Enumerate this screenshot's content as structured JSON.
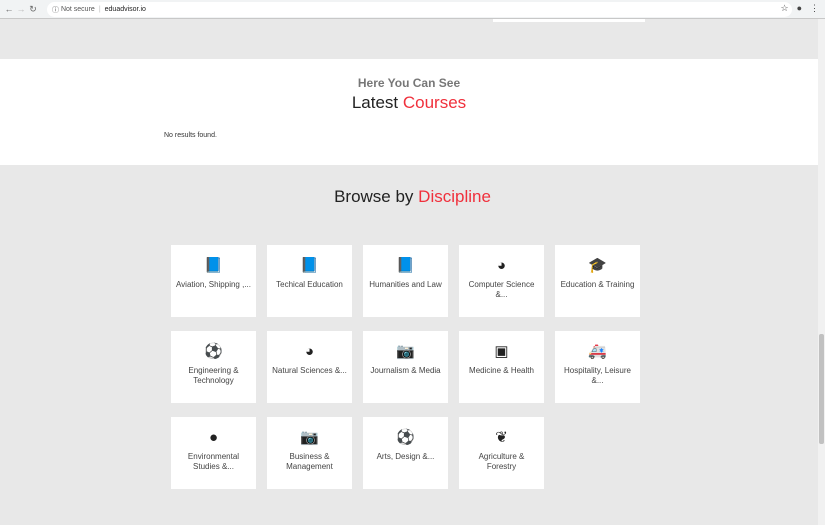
{
  "browser": {
    "security": "Not secure",
    "url": "eduadvisor.io"
  },
  "latest": {
    "subtitle": "Here You Can See",
    "title": "Latest",
    "title_accent": "Courses",
    "empty": "No results found."
  },
  "browse": {
    "title": "Browse by",
    "title_accent": "Discipline"
  },
  "colors": {
    "accent": "#f0303c"
  },
  "disciplines": [
    {
      "label": "Aviation, Shipping ,...",
      "icon": "book-icon",
      "glyph": "📘"
    },
    {
      "label": "Techical Education",
      "icon": "book-icon",
      "glyph": "📘"
    },
    {
      "label": "Humanities and Law",
      "icon": "book-icon",
      "glyph": "📘"
    },
    {
      "label": "Computer Science &...",
      "icon": "pie-chart-icon",
      "glyph": "◕"
    },
    {
      "label": "Education & Training",
      "icon": "graduation-cap-icon",
      "glyph": "🎓"
    },
    {
      "label": "Engineering & Technology",
      "icon": "soccer-ball-icon",
      "glyph": "⚽"
    },
    {
      "label": "Natural Sciences &...",
      "icon": "pie-chart-icon",
      "glyph": "◕"
    },
    {
      "label": "Journalism & Media",
      "icon": "camera-icon",
      "glyph": "📷"
    },
    {
      "label": "Medicine & Health",
      "icon": "archive-icon",
      "glyph": "▣"
    },
    {
      "label": "Hospitality, Leisure &...",
      "icon": "ambulance-icon",
      "glyph": "🚑"
    },
    {
      "label": "Environmental Studies &...",
      "icon": "globe-icon",
      "glyph": "●"
    },
    {
      "label": "Business & Management",
      "icon": "camera-icon",
      "glyph": "📷"
    },
    {
      "label": "Arts, Design &...",
      "icon": "soccer-ball-icon",
      "glyph": "⚽"
    },
    {
      "label": "Agriculture & Forestry",
      "icon": "leaf-icon",
      "glyph": "❦"
    }
  ]
}
